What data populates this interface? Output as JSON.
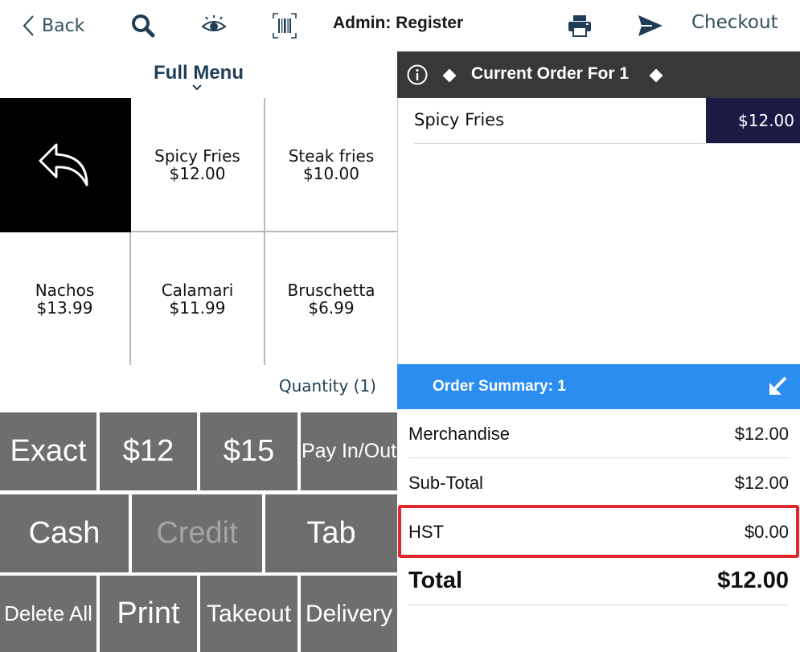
{
  "topbar": {
    "back_label": "Back",
    "title": "Admin: Register",
    "checkout_label": "Checkout",
    "icons": [
      "chevron-left-icon",
      "search-icon",
      "eye-icon",
      "barcode-icon",
      "printer-icon",
      "send-icon"
    ],
    "accent_color": "#2f4f5e"
  },
  "menu": {
    "title": "Full Menu",
    "items": [
      {
        "name": "Spicy Fries",
        "price": "$12.00"
      },
      {
        "name": "Steak fries",
        "price": "$10.00"
      },
      {
        "name": "Nachos",
        "price": "$13.99"
      },
      {
        "name": "Calamari",
        "price": "$11.99"
      },
      {
        "name": "Bruschetta",
        "price": "$6.99"
      }
    ],
    "quantity_label": "Quantity (1)"
  },
  "keypad": {
    "row1": [
      "Exact",
      "$12",
      "$15",
      "Pay In/Out"
    ],
    "row2": [
      "Cash",
      "Credit",
      "Tab"
    ],
    "row3": [
      "Delete All",
      "Print",
      "Takeout",
      "Delivery"
    ],
    "key_color": "#6e6e6e"
  },
  "order": {
    "title": "Current Order For 1",
    "items": [
      {
        "name": "Spicy Fries",
        "price": "$12.00"
      }
    ],
    "header_color": "#383838",
    "price_color": "#1b1a44"
  },
  "summary": {
    "title": "Order Summary: 1",
    "header_color": "#2b8df0",
    "merchandise_label": "Merchandise",
    "merchandise_value": "$12.00",
    "subtotal_label": "Sub-Total",
    "subtotal_value": "$12.00",
    "tax_label": "HST",
    "tax_value": "$0.00",
    "total_label": "Total",
    "total_value": "$12.00",
    "highlight_color": "#e0262f"
  }
}
